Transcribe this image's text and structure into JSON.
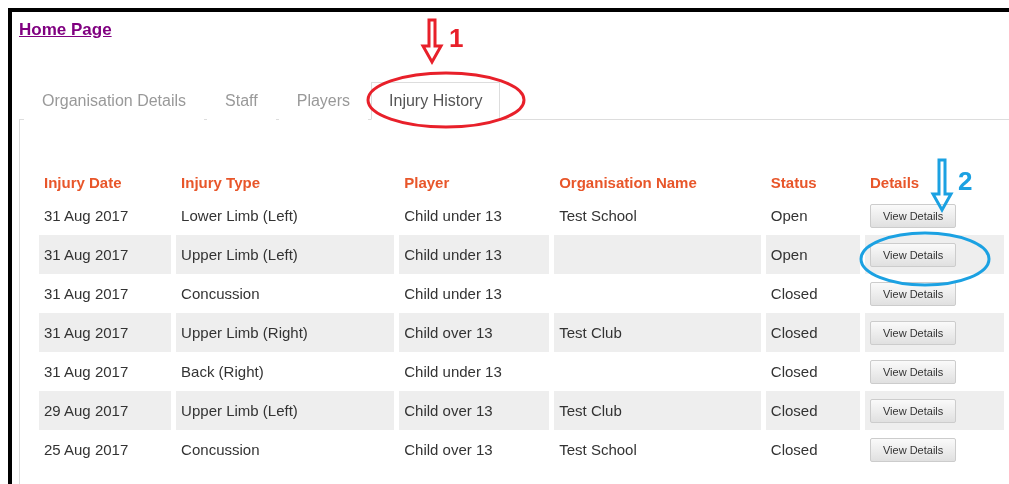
{
  "home_link": "Home Page",
  "tabs": [
    {
      "label": "Organisation Details",
      "selected": false
    },
    {
      "label": "Staff",
      "selected": false
    },
    {
      "label": "Players",
      "selected": false
    },
    {
      "label": "Injury History",
      "selected": true
    }
  ],
  "table": {
    "columns": [
      "Injury Date",
      "Injury Type",
      "Player",
      "Organisation Name",
      "Status",
      "Details"
    ],
    "rows": [
      {
        "date": "31 Aug 2017",
        "type": "Lower Limb (Left)",
        "player": "Child under 13",
        "organisation": "Test School",
        "status": "Open",
        "action": "View Details"
      },
      {
        "date": "31 Aug 2017",
        "type": "Upper Limb (Left)",
        "player": "Child under 13",
        "organisation": "",
        "status": "Open",
        "action": "View Details"
      },
      {
        "date": "31 Aug 2017",
        "type": "Concussion",
        "player": "Child under 13",
        "organisation": "",
        "status": "Closed",
        "action": "View Details"
      },
      {
        "date": "31 Aug 2017",
        "type": "Upper Limb (Right)",
        "player": "Child over 13",
        "organisation": "Test Club",
        "status": "Closed",
        "action": "View Details"
      },
      {
        "date": "31 Aug 2017",
        "type": "Back (Right)",
        "player": "Child under 13",
        "organisation": "",
        "status": "Closed",
        "action": "View Details"
      },
      {
        "date": "29 Aug 2017",
        "type": "Upper Limb (Left)",
        "player": "Child over 13",
        "organisation": "Test Club",
        "status": "Closed",
        "action": "View Details"
      },
      {
        "date": "25 Aug 2017",
        "type": "Concussion",
        "player": "Child over 13",
        "organisation": "Test School",
        "status": "Closed",
        "action": "View Details"
      }
    ]
  },
  "annotations": [
    {
      "label": "1",
      "color": "#e8202a"
    },
    {
      "label": "2",
      "color": "#1ba1e2"
    }
  ]
}
